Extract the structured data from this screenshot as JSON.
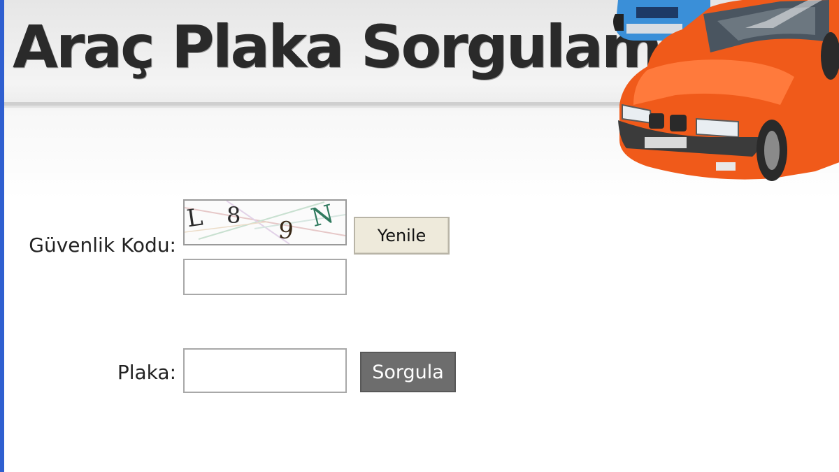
{
  "header": {
    "title": "Araç Plaka Sorgulama"
  },
  "form": {
    "security_label": "Güvenlik Kodu:",
    "captcha_chars": [
      "L",
      "8",
      "9",
      "N"
    ],
    "refresh_label": "Yenile",
    "security_value": "",
    "plate_label": "Plaka:",
    "plate_value": "",
    "query_label": "Sorgula"
  },
  "colors": {
    "accent_edge": "#2f5fd0",
    "car_orange": "#f05a1a",
    "car_blue": "#3a8fd8",
    "query_button": "#6d6d6d",
    "refresh_button": "#eeeadb"
  },
  "icons": {
    "header_image": "cars-illustration"
  }
}
